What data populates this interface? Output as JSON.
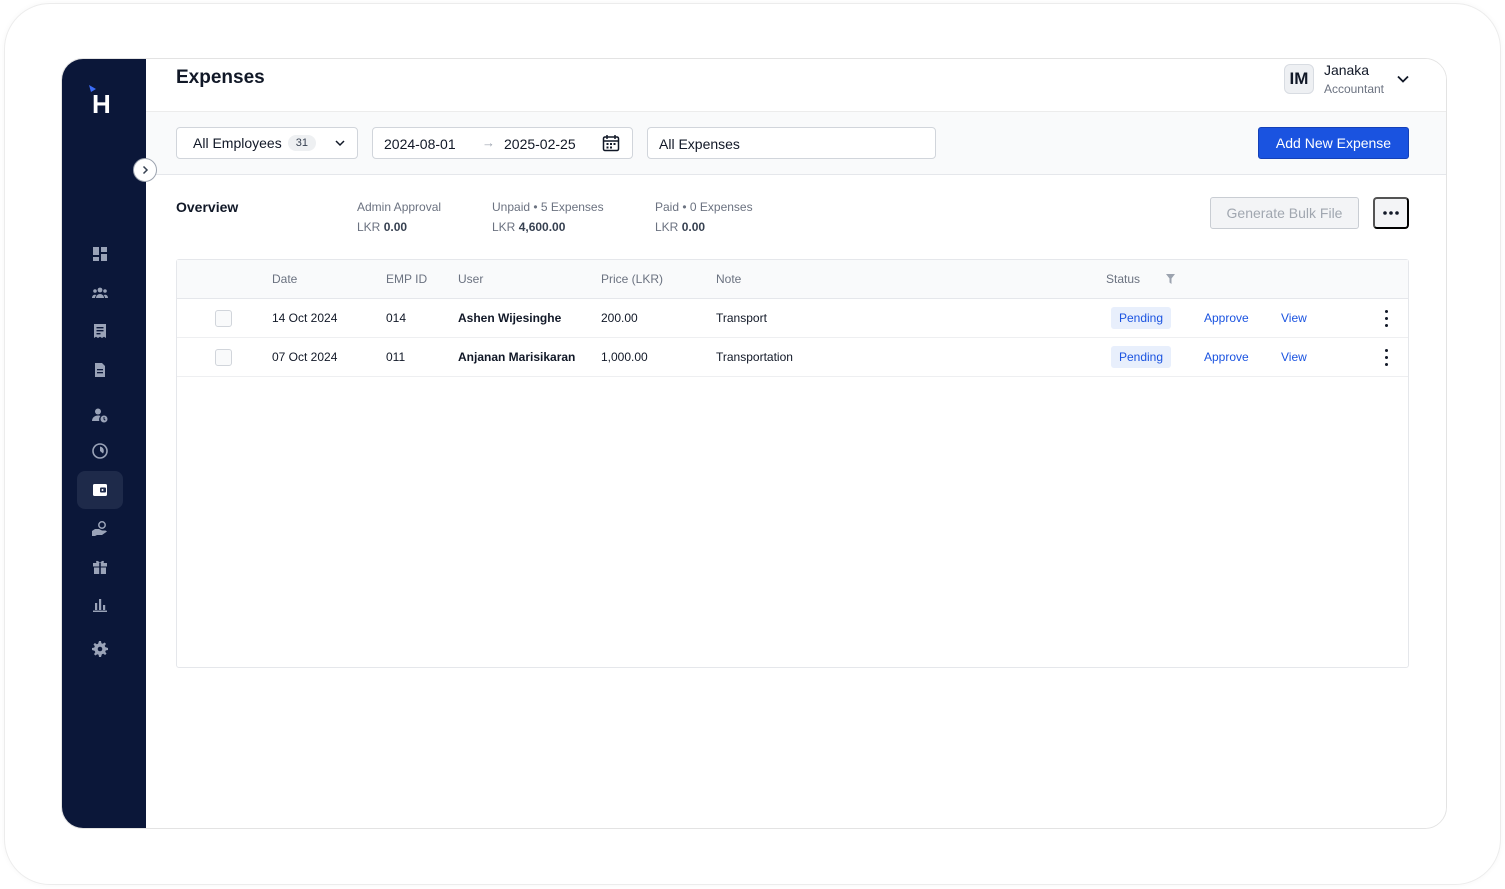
{
  "app": {
    "logo_letter": "H"
  },
  "header": {
    "title": "Expenses"
  },
  "user": {
    "initials": "IM",
    "name": "Janaka",
    "role": "Accountant"
  },
  "filters": {
    "employees_label": "All Employees",
    "employees_count": "31",
    "date_from": "2024-08-01",
    "date_arrow": "→",
    "date_to": "2025-02-25",
    "expense_type": "All Expenses",
    "add_button": "Add New Expense"
  },
  "overview": {
    "title": "Overview",
    "stats": [
      {
        "label": "Admin Approval",
        "currency": "LKR",
        "amount": "0.00"
      },
      {
        "label": "Unpaid • 5 Expenses",
        "currency": "LKR",
        "amount": "4,600.00"
      },
      {
        "label": "Paid • 0 Expenses",
        "currency": "LKR",
        "amount": "0.00"
      }
    ],
    "bulk_button": "Generate Bulk File"
  },
  "table": {
    "columns": [
      "Date",
      "EMP ID",
      "User",
      "Price (LKR)",
      "Note",
      "Status"
    ],
    "rows": [
      {
        "date": "14 Oct 2024",
        "emp_id": "014",
        "user": "Ashen Wijesinghe",
        "price": "200.00",
        "note": "Transport",
        "status": "Pending",
        "approve": "Approve",
        "view": "View"
      },
      {
        "date": "07 Oct 2024",
        "emp_id": "011",
        "user": "Anjanan Marisikaran",
        "price": "1,000.00",
        "note": "Transportation",
        "status": "Pending",
        "approve": "Approve",
        "view": "View"
      }
    ]
  },
  "icons": {
    "sidebar": [
      "dashboard-icon",
      "team-icon",
      "receipt-icon",
      "document-icon",
      "user-clock-icon",
      "clock-icon",
      "wallet-icon",
      "hand-coin-icon",
      "gift-icon",
      "chart-icon",
      "settings-icon"
    ],
    "active": "wallet-icon"
  },
  "colors": {
    "sidebar_bg": "#0b1739",
    "primary": "#1a53e0",
    "logo_accent": "#3b6cf6"
  }
}
